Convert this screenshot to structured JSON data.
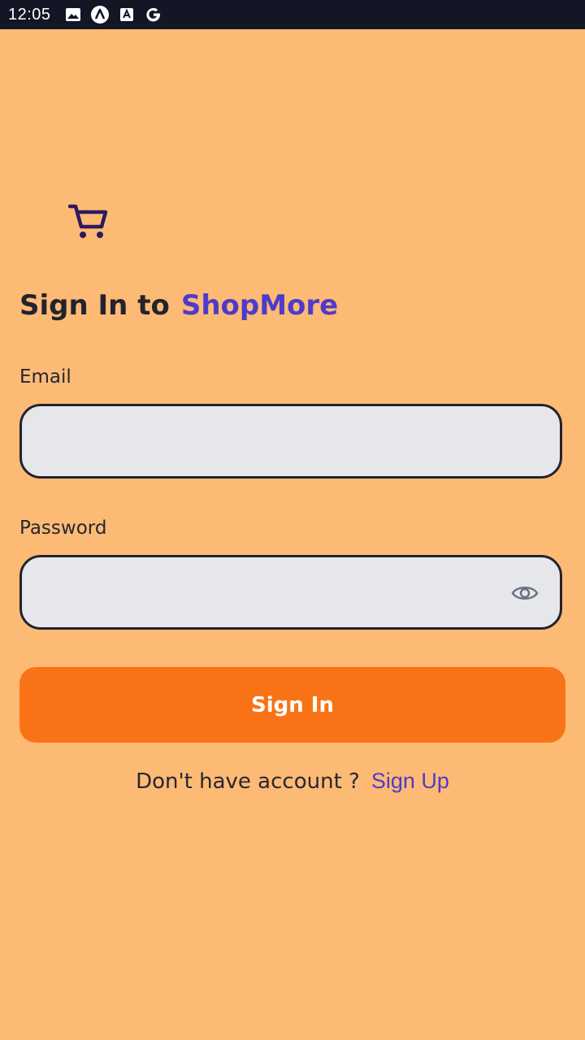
{
  "status_bar": {
    "time": "12:05",
    "icons": [
      "image-icon",
      "app-a-icon",
      "text-a-icon",
      "google-icon"
    ]
  },
  "logo": {
    "icon": "shopping-cart-icon",
    "color": "#2E1A5C"
  },
  "title": {
    "prefix": "Sign In to",
    "brand": "ShopMore",
    "brand_color": "#4F3BC9"
  },
  "form": {
    "email": {
      "label": "Email",
      "value": "",
      "placeholder": ""
    },
    "password": {
      "label": "Password",
      "value": "",
      "placeholder": "",
      "toggle_icon": "eye-icon"
    },
    "submit_label": "Sign In"
  },
  "footer": {
    "prompt": "Don't have account ?",
    "link_label": "Sign Up"
  },
  "colors": {
    "background": "#FDBA74",
    "button": "#F97316",
    "input_bg": "#E5E7EB",
    "accent": "#4F3BC9"
  }
}
